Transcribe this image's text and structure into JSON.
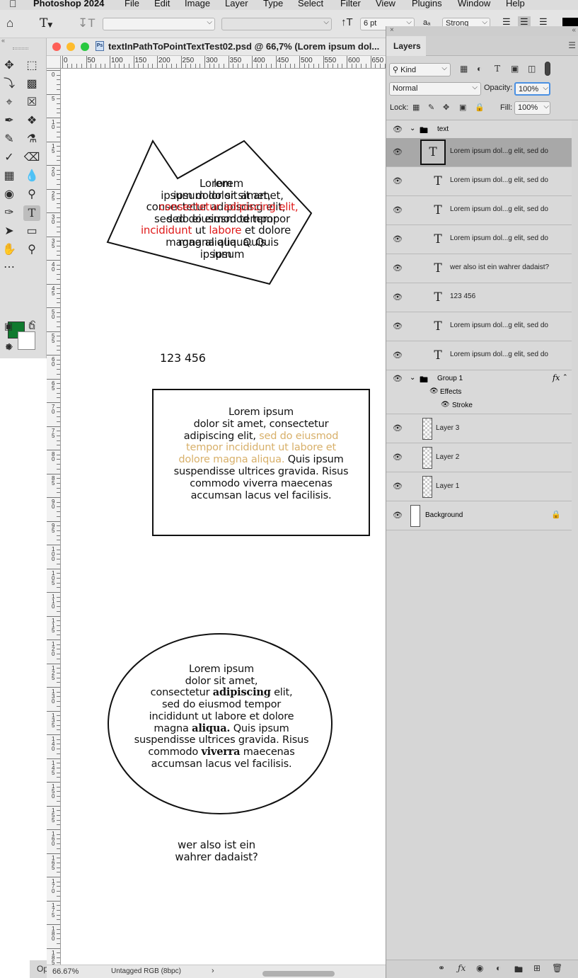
{
  "menubar": {
    "app": "Photoshop 2024",
    "items": [
      "File",
      "Edit",
      "Image",
      "Layer",
      "Type",
      "Select",
      "Filter",
      "View",
      "Plugins",
      "Window",
      "Help"
    ]
  },
  "options": {
    "font_size": "6 pt",
    "antialias": "Strong",
    "aa_label": "aₐ"
  },
  "document": {
    "title": "textInPathToPointTextTest02.psd @ 66,7% (Lorem ipsum dol...",
    "ruler_h": [
      "0",
      "50",
      "100",
      "150",
      "200",
      "250",
      "300",
      "350",
      "400",
      "450",
      "500",
      "550",
      "600",
      "650"
    ],
    "ruler_v": [
      "0",
      "5",
      "1 0",
      "1 5",
      "2 0",
      "2 5",
      "3 0",
      "3 5",
      "4 0",
      "4 5",
      "5 0",
      "5 5",
      "6 0",
      "6 5",
      "7 0",
      "7 5",
      "8 0",
      "8 5",
      "9 0",
      "9 5",
      "1 0 0",
      "1 0 5",
      "1 1 0",
      "1 1 5",
      "1 2 0",
      "1 2 5",
      "1 3 0",
      "1 3 5",
      "1 4 0",
      "1 4 5",
      "1 5 0",
      "1 5 5",
      "1 6 0",
      "1 6 5",
      "1 7 0",
      "1 7 5",
      "1 8 0",
      "1 8 5"
    ],
    "zoom": "66.67%",
    "profile": "Untagged RGB (8bpc)",
    "left_stub": "Op"
  },
  "canvas": {
    "poly_text": [
      {
        "a": "Lorem",
        "b": "lorem"
      },
      {
        "a": "ipsum dolor sit amet,",
        "b": "ipsum dolor sit amet,"
      },
      {
        "a": "consectetur adipiscing elit,",
        "b": "consectetur adipiscing elit,"
      },
      {
        "a": "sed do eiusmod tempor",
        "b": "sed do eiusmod tempor"
      },
      {
        "a": "incididunt",
        "b": "ut",
        "c": "labore",
        "d": "et dolore"
      },
      {
        "a": "magna aliqua. Quis",
        "b": "magna aliqua. Quis"
      },
      {
        "a": "ipsum",
        "b": "ipsum"
      }
    ],
    "point_text_1": "123 456",
    "rect_text": {
      "l1": "Lorem ipsum",
      "l2": "dolor sit amet, consectetur",
      "l3a": "adipiscing elit,",
      "l3b": "sed do eiusmod",
      "l4": "tempor incididunt ut labore et",
      "l5a": "dolore magna aliqua.",
      "l5b": "Quis ipsum",
      "l6": "suspendisse ultrices gravida. Risus",
      "l7": "commodo viverra maecenas",
      "l8": "accumsan lacus vel facilisis."
    },
    "ellipse_text": {
      "l1": "Lorem ipsum",
      "l2": "dolor sit amet,",
      "l3a": "consectetur",
      "l3b": "adipiscing",
      "l3c": "elit,",
      "l4": "sed do eiusmod tempor",
      "l5": "incididunt ut labore et dolore",
      "l6a": "magna",
      "l6b": "aliqua.",
      "l6c": "Quis ipsum",
      "l7": "suspendisse ultrices gravida. Risus",
      "l8a": "commodo",
      "l8b": "viverra",
      "l8c": "maecenas",
      "l9": "accumsan lacus vel facilisis."
    },
    "point_text_2": {
      "l1": "wer also ist ein",
      "l2": "wahrer dadaist?"
    },
    "colors": {
      "red": "#e01b1b",
      "tan": "#d8b06a",
      "toolbar_fg": "#0f7a2e"
    }
  },
  "layers_panel": {
    "tab": "Layers",
    "filter_kind": "Kind",
    "blend_mode": "Normal",
    "opacity_label": "Opacity:",
    "opacity": "100%",
    "lock_label": "Lock:",
    "fill_label": "Fill:",
    "fill": "100%",
    "group_text": "text",
    "group_1": "Group 1",
    "effects_label": "Effects",
    "stroke_label": "Stroke",
    "fx": "fx",
    "text_layers": [
      "Lorem ipsum dol...g elit, sed do",
      "Lorem ipsum dol...g elit, sed do",
      "Lorem ipsum dol...g elit, sed do",
      "Lorem ipsum dol...g elit, sed do",
      "wer also ist ein wahrer dadaist?",
      "123 456",
      "Lorem ipsum dol...g elit, sed do",
      "Lorem ipsum dol...g elit, sed do"
    ],
    "pixel_layers": [
      "Layer 3",
      "Layer 2",
      "Layer 1"
    ],
    "background": "Background"
  }
}
